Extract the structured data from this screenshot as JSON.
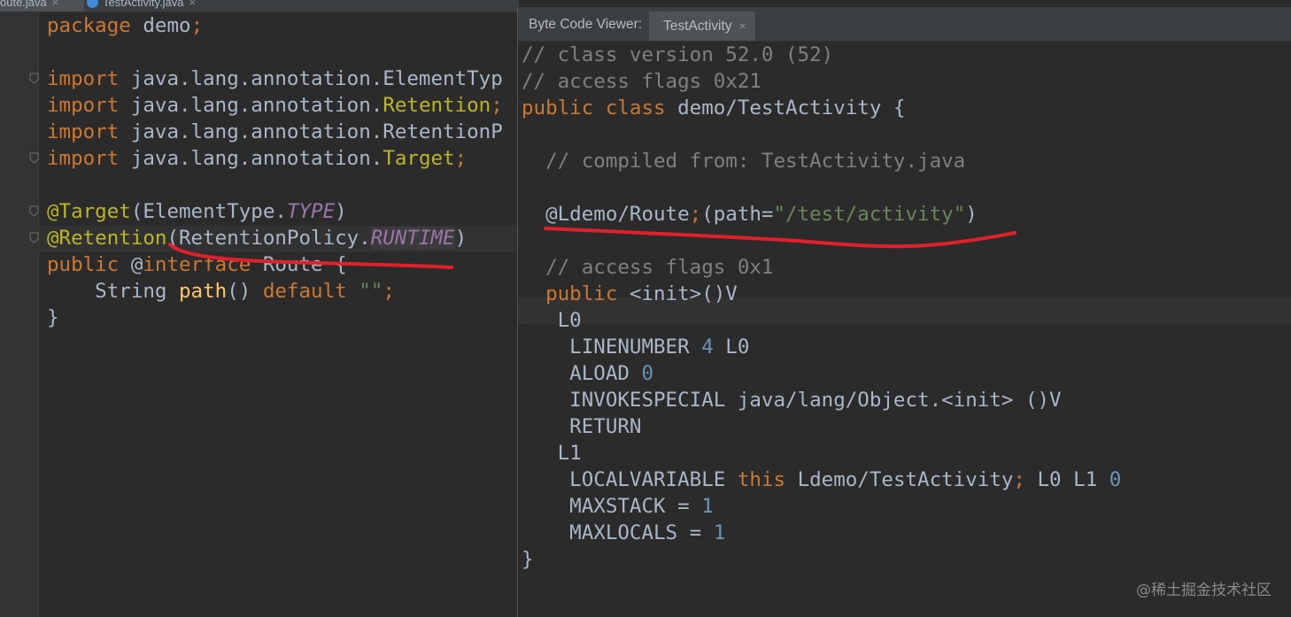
{
  "editor": {
    "tabs": [
      {
        "label": "oute.java",
        "close": "×"
      },
      {
        "label": "TestActivity.java",
        "close": "×"
      }
    ],
    "lines": [
      [
        {
          "t": "package ",
          "c": "kw"
        },
        {
          "t": "demo",
          "c": "id"
        },
        {
          "t": ";",
          "c": "kw"
        }
      ],
      [],
      [
        {
          "t": "import ",
          "c": "kw"
        },
        {
          "t": "java.lang.annotation.ElementTyp",
          "c": "id"
        }
      ],
      [
        {
          "t": "import ",
          "c": "kw"
        },
        {
          "t": "java.lang.annotation.",
          "c": "id"
        },
        {
          "t": "Retention",
          "c": "ann"
        },
        {
          "t": ";",
          "c": "kw"
        }
      ],
      [
        {
          "t": "import ",
          "c": "kw"
        },
        {
          "t": "java.lang.annotation.RetentionP",
          "c": "id"
        }
      ],
      [
        {
          "t": "import ",
          "c": "kw"
        },
        {
          "t": "java.lang.annotation.",
          "c": "id"
        },
        {
          "t": "Target",
          "c": "ann"
        },
        {
          "t": ";",
          "c": "kw"
        }
      ],
      [],
      [
        {
          "t": "@Target",
          "c": "ann"
        },
        {
          "t": "(ElementType.",
          "c": "id"
        },
        {
          "t": "TYPE",
          "c": "const"
        },
        {
          "t": ")",
          "c": "id"
        }
      ],
      [
        {
          "t": "@Retention",
          "c": "ann"
        },
        {
          "t": "(RetentionPolicy.",
          "c": "id"
        },
        {
          "t": "RUNTIME",
          "c": "const hlbg"
        },
        {
          "t": ")",
          "c": "id"
        }
      ],
      [
        {
          "t": "public ",
          "c": "kw"
        },
        {
          "t": "@",
          "c": "id"
        },
        {
          "t": "interface ",
          "c": "kw"
        },
        {
          "t": "Route {",
          "c": "id"
        }
      ],
      [
        {
          "t": "    String ",
          "c": "id"
        },
        {
          "t": "path",
          "c": "fn"
        },
        {
          "t": "() ",
          "c": "id"
        },
        {
          "t": "default ",
          "c": "kw"
        },
        {
          "t": "\"\"",
          "c": "str"
        },
        {
          "t": ";",
          "c": "kw"
        }
      ],
      [
        {
          "t": "}",
          "c": "id"
        }
      ]
    ],
    "folds": [
      2,
      5,
      7,
      8
    ]
  },
  "viewer": {
    "title": "Byte Code Viewer:",
    "tab_label": "TestActivity",
    "tab_close": "×",
    "lines": [
      [
        {
          "t": "// class version 52.0 (52)",
          "c": "cm"
        }
      ],
      [
        {
          "t": "// access flags 0x21",
          "c": "cm"
        }
      ],
      [
        {
          "t": "public class ",
          "c": "kw"
        },
        {
          "t": "demo/TestActivity {",
          "c": "id"
        }
      ],
      [],
      [
        {
          "t": "  // compiled from: TestActivity.java",
          "c": "cm"
        }
      ],
      [],
      [
        {
          "t": "  @Ldemo/Route",
          "c": "id"
        },
        {
          "t": ";",
          "c": "kw"
        },
        {
          "t": "(path=",
          "c": "id"
        },
        {
          "t": "\"/test/activity\"",
          "c": "str"
        },
        {
          "t": ")",
          "c": "id"
        }
      ],
      [],
      [
        {
          "t": "  // access flags 0x1",
          "c": "cm"
        }
      ],
      [
        {
          "t": "  public ",
          "c": "kw"
        },
        {
          "t": "<init>()V",
          "c": "id"
        }
      ],
      [
        {
          "t": "   L0",
          "c": "id"
        }
      ],
      [
        {
          "t": "    LINENUMBER ",
          "c": "id"
        },
        {
          "t": "4",
          "c": "num"
        },
        {
          "t": " L0",
          "c": "id"
        }
      ],
      [
        {
          "t": "    ALOAD ",
          "c": "id"
        },
        {
          "t": "0",
          "c": "num"
        }
      ],
      [
        {
          "t": "    INVOKESPECIAL java/lang/Object.<init> ()V",
          "c": "id"
        }
      ],
      [
        {
          "t": "    RETURN",
          "c": "id"
        }
      ],
      [
        {
          "t": "   L1",
          "c": "id"
        }
      ],
      [
        {
          "t": "    LOCALVARIABLE ",
          "c": "id"
        },
        {
          "t": "this ",
          "c": "kw"
        },
        {
          "t": "Ldemo/TestActivity",
          "c": "id"
        },
        {
          "t": ";",
          "c": "kw"
        },
        {
          "t": " L0 L1 ",
          "c": "id"
        },
        {
          "t": "0",
          "c": "num"
        }
      ],
      [
        {
          "t": "    MAXSTACK = ",
          "c": "id"
        },
        {
          "t": "1",
          "c": "num"
        }
      ],
      [
        {
          "t": "    MAXLOCALS = ",
          "c": "id"
        },
        {
          "t": "1",
          "c": "num"
        }
      ],
      [
        {
          "t": "}",
          "c": "id"
        }
      ]
    ]
  },
  "watermark": "@稀土掘金技术社区",
  "colors": {
    "keyword": "#cc7832",
    "identifier": "#a9b7c6",
    "annotation": "#bbb529",
    "constant": "#9876aa",
    "method": "#ffc66d",
    "string": "#6a8759",
    "number": "#6897bb",
    "comment": "#808080",
    "annotation_mark": "#e0202a"
  }
}
